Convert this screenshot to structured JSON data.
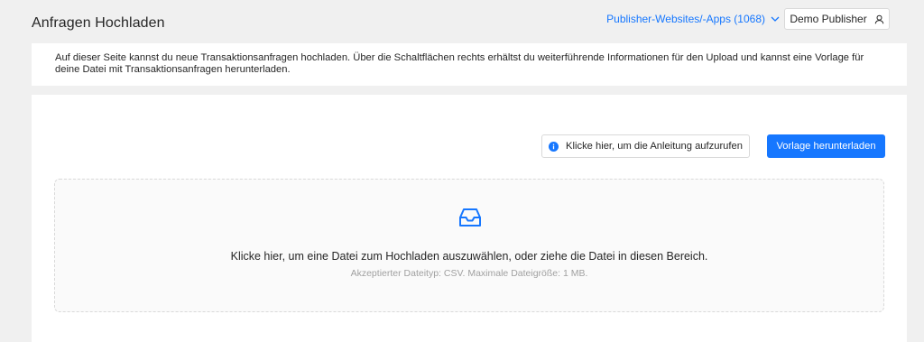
{
  "header": {
    "title": "Anfragen Hochladen",
    "publisher_select": "Publisher-Websites/-Apps (1068)",
    "user_button": "Demo Publisher"
  },
  "info": {
    "text": "Auf dieser Seite kannst du neue Transaktionsanfragen hochladen. Über die Schaltflächen rechts erhältst du weiterführende Informationen für den Upload und kannst eine Vorlage für deine Datei mit Transaktionsanfragen herunterladen."
  },
  "actions": {
    "help_label": "Klicke hier, um die Anleitung aufzurufen",
    "download_label": "Vorlage herunterladen"
  },
  "dropzone": {
    "text": "Klicke hier, um eine Datei zum Hochladen auszuwählen, oder ziehe die Datei in diesen Bereich.",
    "hint": "Akzeptierter Dateityp: CSV. Maximale Dateigröße: 1 MB."
  },
  "colors": {
    "accent": "#1677ff",
    "background": "#f0f0f0",
    "card": "#ffffff"
  },
  "icons": {
    "publisher_select": "chevron-down-icon",
    "user_button": "user-icon",
    "help_button": "info-icon",
    "dropzone": "inbox-icon"
  }
}
